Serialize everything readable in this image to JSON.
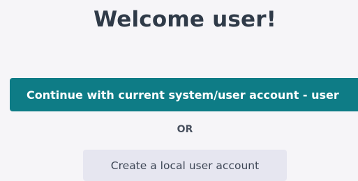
{
  "welcome": {
    "title": "Welcome user!"
  },
  "actions": {
    "continue_label": "Continue with current system/user account - user",
    "separator": "OR",
    "create_local_label": "Create a local user account"
  },
  "colors": {
    "primary": "#0e7c86",
    "secondary": "#e6e6f0",
    "background": "#f6f5f8",
    "title_text": "#2f3a48"
  }
}
